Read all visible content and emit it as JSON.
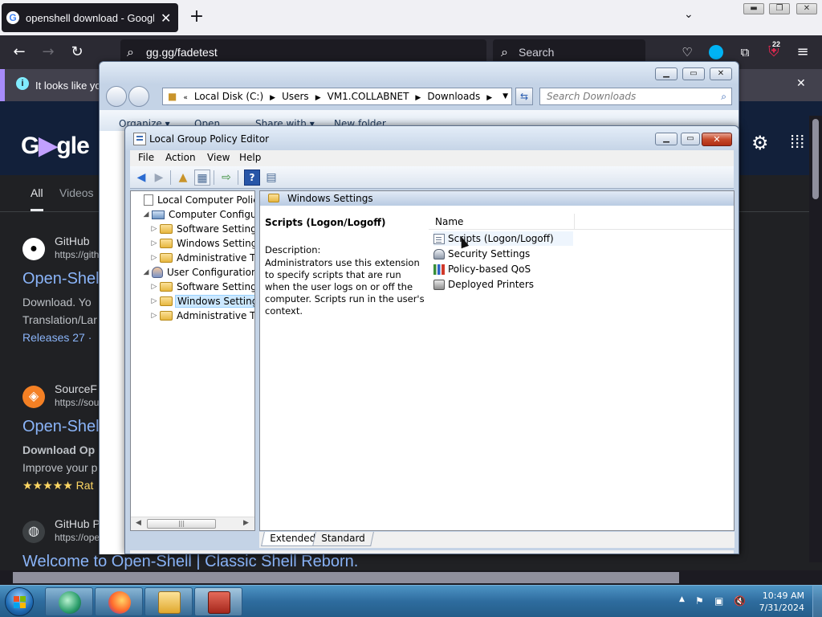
{
  "firefox": {
    "tab_title": "openshell download - Google S",
    "tab_favicon": "G",
    "tab_close": "✕",
    "new_tab": "+",
    "tab_list": "⌄",
    "url": "gg.gg/fadetest",
    "search_placeholder": "Search",
    "badge_count": "22",
    "info_text": "It looks like you",
    "info_icon": "i",
    "info_close": "✕"
  },
  "google": {
    "gear": "⚙",
    "apps": "⋮⋮⋮",
    "tabs": [
      "All",
      "Videos"
    ],
    "results": [
      {
        "site": "GitHub",
        "url": "https://gith",
        "title": "Open-Shel",
        "snippet1": "Download. Yo",
        "snippet2": "Translation/Lar",
        "snippet3": "Releases 27 ·"
      },
      {
        "site": "SourceF",
        "url": "https://sou",
        "title": "Open-Shel",
        "snippet1": "Download Op",
        "snippet2": "Improve your p",
        "snippet3": "★★★★★ Rat"
      },
      {
        "site": "GitHub P",
        "url": "https://open",
        "title": "Welcome to Open-Shell | Classic Shell Reborn."
      }
    ]
  },
  "explorer": {
    "breadcrumbs": [
      "Local Disk (C:)",
      "Users",
      "VM1.COLLABNET",
      "Downloads"
    ],
    "search_placeholder": "Search Downloads",
    "commands": [
      "Organize ▾",
      "Open",
      "Share with ▾",
      "New folder"
    ]
  },
  "gpedit": {
    "title": "Local Group Policy Editor",
    "menu": [
      "File",
      "Action",
      "View",
      "Help"
    ],
    "tree": [
      {
        "label": "Local Computer Policy",
        "exp": "",
        "icon": "doc",
        "level": 0
      },
      {
        "label": "Computer Configura",
        "exp": "◢",
        "icon": "computer",
        "level": 1
      },
      {
        "label": "Software Settings",
        "exp": "▷",
        "icon": "folder",
        "level": 2
      },
      {
        "label": "Windows Setting",
        "exp": "▷",
        "icon": "folder",
        "level": 2
      },
      {
        "label": "Administrative Te",
        "exp": "▷",
        "icon": "folder",
        "level": 2
      },
      {
        "label": "User Configuration",
        "exp": "◢",
        "icon": "user",
        "level": 1
      },
      {
        "label": "Software Settings",
        "exp": "▷",
        "icon": "folder",
        "level": 2
      },
      {
        "label": "Windows Setting",
        "exp": "▷",
        "icon": "folder",
        "level": 2,
        "selected": true
      },
      {
        "label": "Administrative Te",
        "exp": "▷",
        "icon": "folder",
        "level": 2
      }
    ],
    "header_title": "Windows Settings",
    "desc_title": "Scripts (Logon/Logoff)",
    "desc_label": "Description:",
    "desc_text": "Administrators use this extension to specify scripts that are run when the user logs on or off the computer. Scripts run in the user's context.",
    "list_header": "Name",
    "items": [
      {
        "label": "Scripts (Logon/Logoff)",
        "icon": "scripts"
      },
      {
        "label": "Security Settings",
        "icon": "security"
      },
      {
        "label": "Policy-based QoS",
        "icon": "qos"
      },
      {
        "label": "Deployed Printers",
        "icon": "printer"
      }
    ],
    "view_tabs": [
      "Extended",
      "Standard"
    ]
  },
  "taskbar": {
    "time": "10:49 AM",
    "date": "7/31/2024"
  }
}
